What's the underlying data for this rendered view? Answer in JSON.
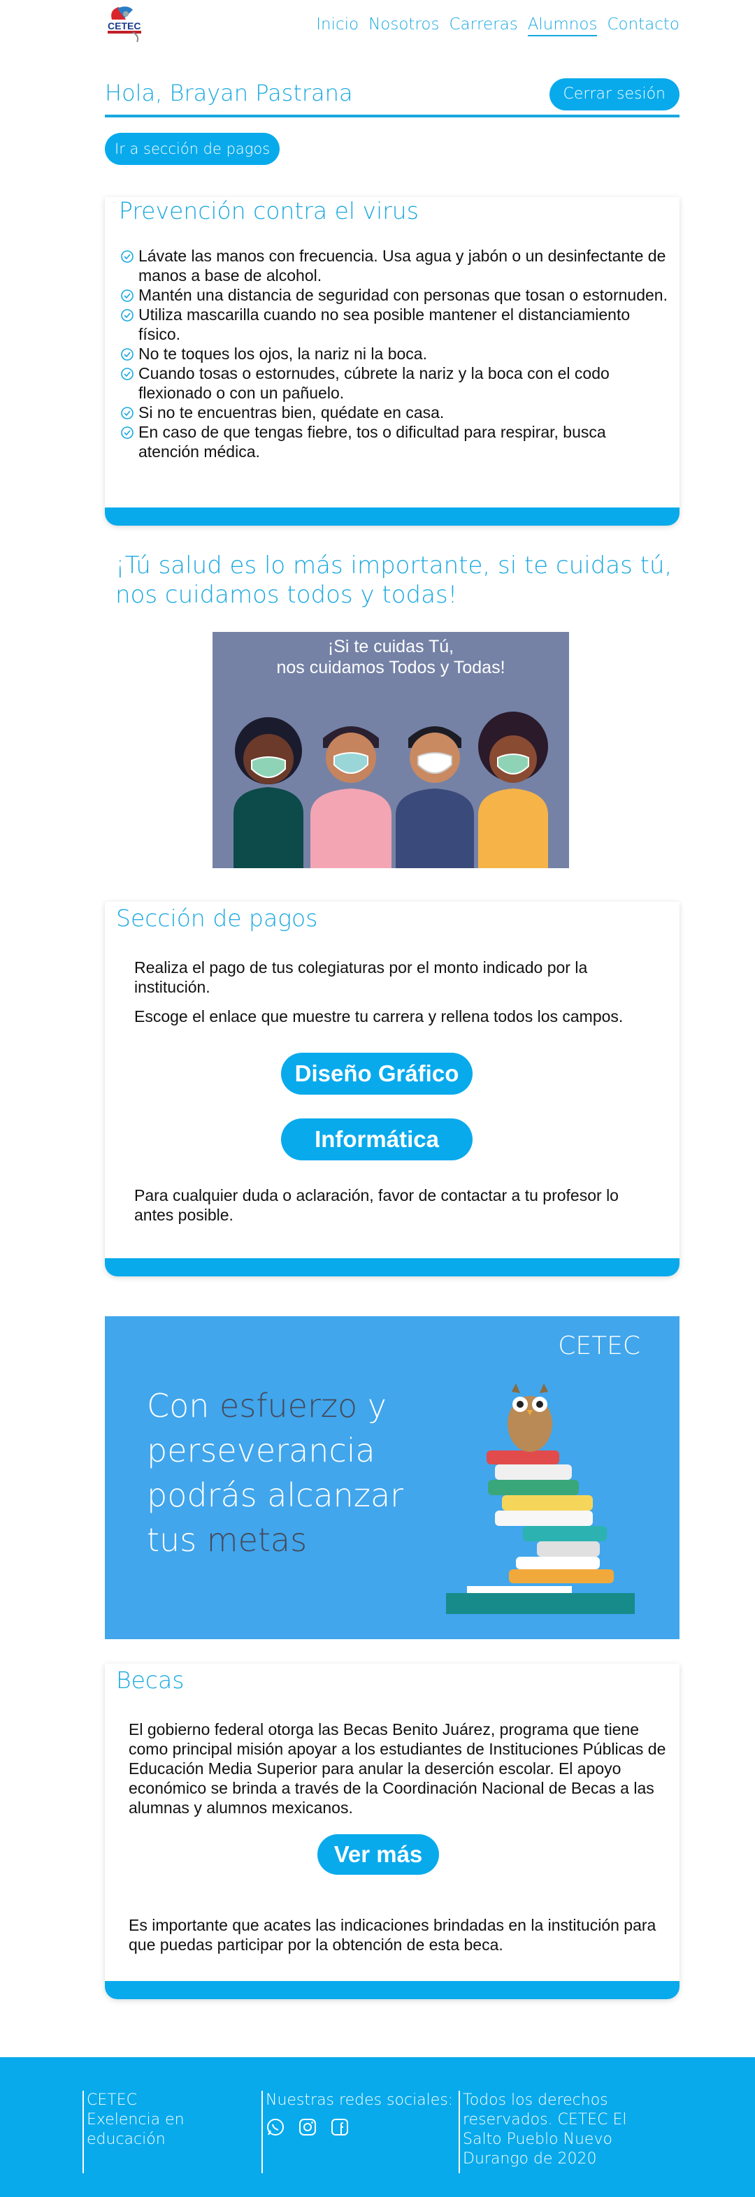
{
  "nav": {
    "logo_text": "CETEC",
    "items": [
      {
        "label": "Inicio"
      },
      {
        "label": "Nosotros"
      },
      {
        "label": "Carreras"
      },
      {
        "label": "Alumnos"
      },
      {
        "label": "Contacto"
      }
    ],
    "active": "Alumnos"
  },
  "header": {
    "greeting": "Hola, Brayan Pastrana",
    "logout_label": "Cerrar sesión",
    "payments_link_label": "Ir a sección de pagos"
  },
  "prevention": {
    "title": "Prevención contra el virus",
    "tips": [
      "Lávate las manos con frecuencia. Usa agua y jabón o un desinfectante de manos a base de alcohol.",
      "Mantén una distancia de seguridad con personas que tosan o estornuden.",
      "Utiliza mascarilla cuando no sea posible mantener el distanciamiento físico.",
      "No te toques los ojos, la nariz ni la boca.",
      "Cuando tosas o estornudes, cúbrete la nariz y la boca con el codo flexionado o con un pañuelo.",
      "Si no te encuentras bien, quédate en casa.",
      "En caso de que tengas fiebre, tos o dificultad para respirar, busca atención médica."
    ]
  },
  "health": {
    "headline": "¡Tú salud es lo más importante, si te cuidas tú, nos cuidamos todos y todas!",
    "image_line1": "¡Si te cuidas Tú,",
    "image_line2": "nos cuidamos Todos y Todas!"
  },
  "payments": {
    "title": "Sección de pagos",
    "text1": "Realiza el pago de tus colegiaturas por el monto indicado por la institución.",
    "text2": "Escoge el enlace que muestre tu carrera y rellena todos los campos.",
    "career1": "Diseño Gráfico",
    "career2": "Informática",
    "text3": "Para cualquier duda o aclaración, favor de contactar a tu profesor lo antes posible."
  },
  "banner": {
    "brand": "CETEC",
    "line1a": "Con ",
    "line1b": "esfuerzo",
    "line1c": " y",
    "line2": "perseverancia",
    "line3": "podrás alcanzar",
    "line4a": "tus ",
    "line4b": "metas"
  },
  "becas": {
    "title": "Becas",
    "text1": "El gobierno federal otorga las Becas Benito Juárez, programa que tiene como principal misión apoyar a los estudiantes de Instituciones Públicas de Educación Media Superior para anular la deserción escolar. El apoyo económico se brinda a través de la Coordinación Nacional de Becas a las alumnas y alumnos mexicanos.",
    "more_label": "Ver más",
    "text2": "Es importante que acates las indicaciones brindadas en la institución para que puedas participar por la obtención de esta beca."
  },
  "footer": {
    "brand": "CETEC",
    "slogan": "Exelencia en educación",
    "social_title": "Nuestras redes sociales:",
    "socials": [
      "whatsapp-icon",
      "instagram-icon",
      "facebook-icon"
    ],
    "rights": "Todos los derechos reservados. CETEC El Salto Pueblo Nuevo Durango de 2020"
  },
  "colors": {
    "primary": "#08aaec",
    "heading": "#18a8e0",
    "banner_bg": "#41a6ec",
    "illustration_bg": "#7582a6"
  }
}
